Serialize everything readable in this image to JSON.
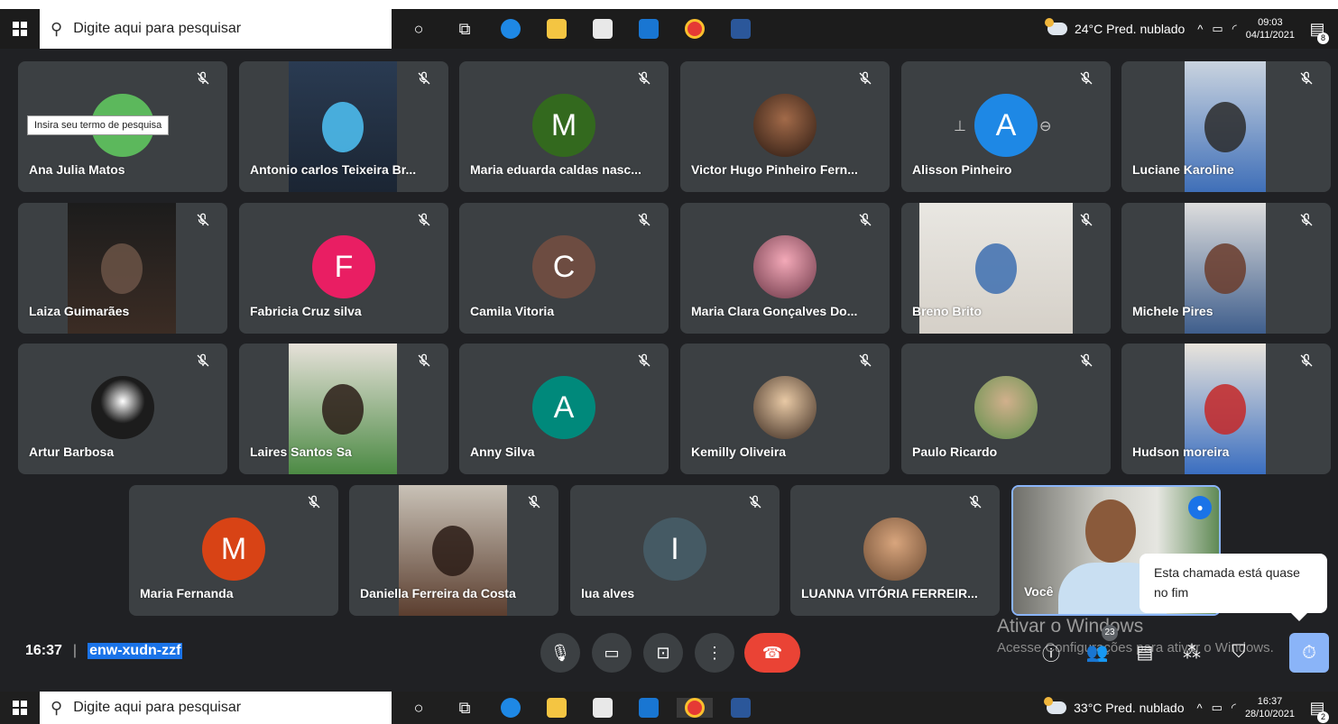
{
  "taskbar_top": {
    "search_placeholder": "Digite aqui para pesquisar",
    "weather": "24°C Pred. nublado",
    "time": "09:03",
    "date": "04/11/2021",
    "notifications": "8"
  },
  "taskbar_bottom": {
    "search_placeholder": "Digite aqui para pesquisar",
    "weather": "33°C Pred. nublado",
    "time": "16:37",
    "date": "28/10/2021",
    "notifications": "2"
  },
  "search_tooltip": "Insira seu termo de pesquisa",
  "participants": [
    {
      "name": "Ana Julia Matos",
      "kind": "letter",
      "color": "#5cb85c"
    },
    {
      "name": "Antonio carlos Teixeira Br...",
      "kind": "video"
    },
    {
      "name": "Maria eduarda caldas nasc...",
      "kind": "letter",
      "letter": "M",
      "color": "#33691e"
    },
    {
      "name": "Victor Hugo Pinheiro Fern...",
      "kind": "photo"
    },
    {
      "name": "Alisson Pinheiro",
      "kind": "letter",
      "letter": "A",
      "color": "#1e88e5"
    },
    {
      "name": "Luciane Karoline",
      "kind": "video"
    },
    {
      "name": "Laiza Guimarães",
      "kind": "video"
    },
    {
      "name": "Fabricia Cruz silva",
      "kind": "letter",
      "letter": "F",
      "color": "#e91e63"
    },
    {
      "name": "Camila Vitoria",
      "kind": "letter",
      "letter": "C",
      "color": "#6d4c41"
    },
    {
      "name": "Maria Clara Gonçalves Do...",
      "kind": "photo"
    },
    {
      "name": "Breno Brito",
      "kind": "video"
    },
    {
      "name": "Michele Pires",
      "kind": "video"
    },
    {
      "name": "Artur Barbosa",
      "kind": "photo"
    },
    {
      "name": "Laires Santos Sa",
      "kind": "video"
    },
    {
      "name": "Anny Silva",
      "kind": "letter",
      "letter": "A",
      "color": "#00897b"
    },
    {
      "name": "Kemilly Oliveira",
      "kind": "photo"
    },
    {
      "name": "Paulo Ricardo",
      "kind": "photo"
    },
    {
      "name": "Hudson moreira",
      "kind": "video"
    },
    {
      "name": "Maria Fernanda",
      "kind": "letter",
      "letter": "M",
      "color": "#d84315"
    },
    {
      "name": "Daniella Ferreira da Costa",
      "kind": "video"
    },
    {
      "name": "lua alves",
      "kind": "letter",
      "letter": "I",
      "color": "#455a64"
    },
    {
      "name": "LUANNA VITÓRIA FERREIR...",
      "kind": "photo"
    },
    {
      "name": "Você",
      "kind": "self"
    }
  ],
  "meeting": {
    "time": "16:37",
    "separator": "|",
    "code": "enw-xudn-zzf",
    "people_count": "23"
  },
  "end_popup": "Esta chamada está quase no fim",
  "watermark": {
    "title": "Ativar o Windows",
    "subtitle": "Acesse Configurações para ativar o Windows."
  },
  "icons": {
    "mute": "mic-off-icon",
    "mic": "mic-icon",
    "camera": "camera-icon",
    "present": "present-icon",
    "more": "more-vert-icon",
    "end": "phone-hangup-icon",
    "info": "info-icon",
    "people": "people-icon",
    "chat": "chat-icon",
    "activities": "activities-icon",
    "host": "shield-lock-icon",
    "timer": "timer-icon"
  }
}
